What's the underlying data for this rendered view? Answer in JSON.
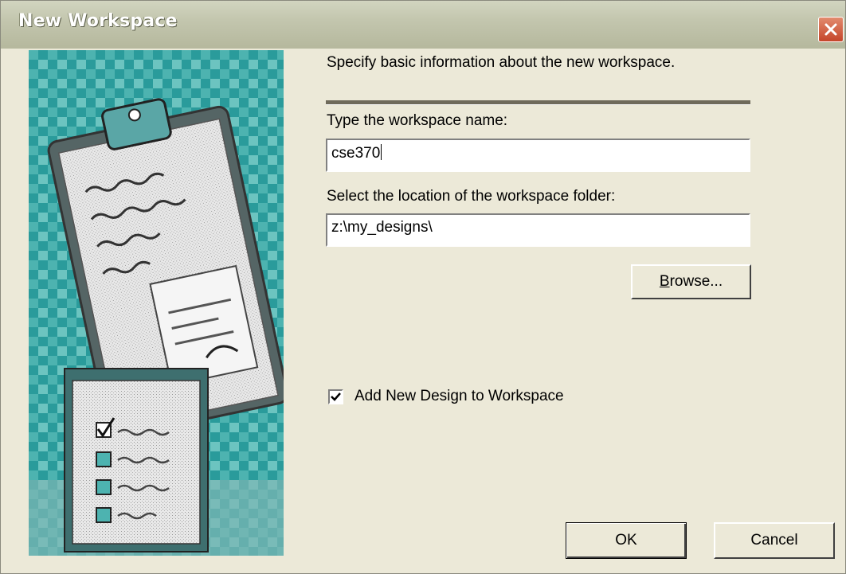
{
  "window": {
    "title": "New Workspace"
  },
  "form": {
    "intro": "Specify basic information about the new workspace.",
    "name_label": "Type the workspace name:",
    "name_value": "cse370",
    "location_label": "Select the location of the workspace folder:",
    "location_value": "z:\\my_designs\\",
    "browse_mnemonic": "B",
    "browse_rest": "rowse...",
    "add_design_label": "Add New Design to Workspace",
    "add_design_checked": true
  },
  "buttons": {
    "ok": "OK",
    "cancel": "Cancel"
  },
  "icons": {
    "close": "close-icon",
    "checkmark": "checkmark-icon",
    "illustration": "clipboard-checklist-illustration"
  },
  "colors": {
    "dialog_bg": "#ece9d8",
    "close_button": "#c5452a",
    "illustration_teal": "#1f8f8f"
  }
}
